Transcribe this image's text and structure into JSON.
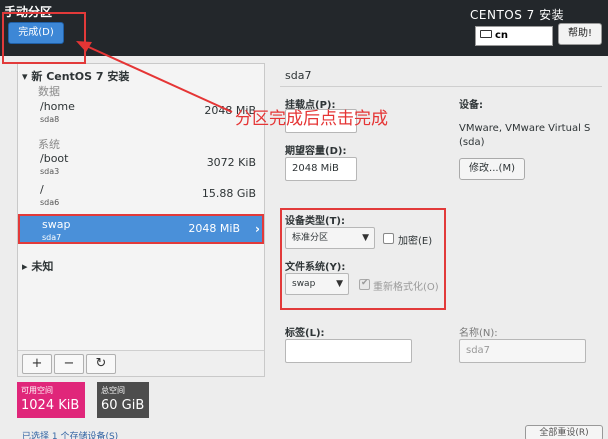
{
  "header": {
    "title": "手动分区",
    "done_label": "完成(D)",
    "product": "CENTOS 7 安装",
    "keyboard": "cn",
    "help_label": "帮助!"
  },
  "annotation": "分区完成后点击完成",
  "partitions": {
    "group_title": "新 CentOS 7 安装",
    "data_label": "数据",
    "system_label": "系统",
    "items": [
      {
        "name": "/home",
        "device": "sda8",
        "size": "2048 MiB"
      },
      {
        "name": "/boot",
        "device": "sda3",
        "size": "3072 KiB"
      },
      {
        "name": "/",
        "device": "sda6",
        "size": "15.88 GiB"
      },
      {
        "name": "swap",
        "device": "sda7",
        "size": "2048 MiB"
      }
    ],
    "unknown_label": "未知",
    "tools": {
      "add": "+",
      "remove": "−",
      "refresh": "↻"
    }
  },
  "space": {
    "available_label": "可用空间",
    "available_value": "1024 KiB",
    "total_label": "总空间",
    "total_value": "60 GiB"
  },
  "detail": {
    "title": "sda7",
    "mount_label": "挂载点(P):",
    "capacity_label": "期望容量(D):",
    "capacity_value": "2048 MiB",
    "device_label": "设备:",
    "device_value": "VMware, VMware Virtual S (sda)",
    "modify_label": "修改...(M)",
    "device_type_label": "设备类型(T):",
    "device_type_value": "标准分区",
    "encrypt_label": "加密(E)",
    "fs_label": "文件系统(Y):",
    "fs_value": "swap",
    "reformat_label": "重新格式化(O)",
    "tag_label": "标签(L):",
    "name_label": "名称(N):",
    "name_placeholder": "sda7"
  },
  "footer": {
    "link": "已选择 1 个存储设备(S)",
    "reset_label": "全部重设(R)"
  },
  "colors": {
    "header_bg": "#23272b",
    "accent": "#4a90d9",
    "available_bg": "#e0267a",
    "total_bg": "#4d4d4d",
    "annotation": "#e53535"
  }
}
